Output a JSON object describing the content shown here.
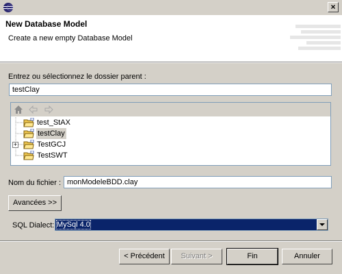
{
  "window": {
    "close_glyph": "×"
  },
  "banner": {
    "title": "New Database Model",
    "description": "Create a new empty Database Model"
  },
  "parent_folder": {
    "label": "Entrez ou sélectionnez le dossier parent :",
    "value": "testClay"
  },
  "tree": {
    "toolbar_icons": [
      "home-icon",
      "back-arrow-icon",
      "forward-arrow-icon"
    ],
    "items": [
      {
        "label": "test_StAX",
        "expandable": false,
        "selected": false
      },
      {
        "label": "testClay",
        "expandable": false,
        "selected": true
      },
      {
        "label": "TestGCJ",
        "expandable": true,
        "selected": false
      },
      {
        "label": "TestSWT",
        "expandable": false,
        "selected": false
      }
    ]
  },
  "file_name": {
    "label": "Nom du fichier :",
    "value": "monModeleBDD.clay"
  },
  "advanced_button": "Avancées >>",
  "dialect": {
    "label": "SQL Dialect:",
    "value": "MySql 4.0"
  },
  "buttons": {
    "back": "< Précédent",
    "next": "Suivant >",
    "finish": "Fin",
    "cancel": "Annuler"
  },
  "colors": {
    "accent": "#0a246a",
    "background": "#d4d0c8"
  }
}
